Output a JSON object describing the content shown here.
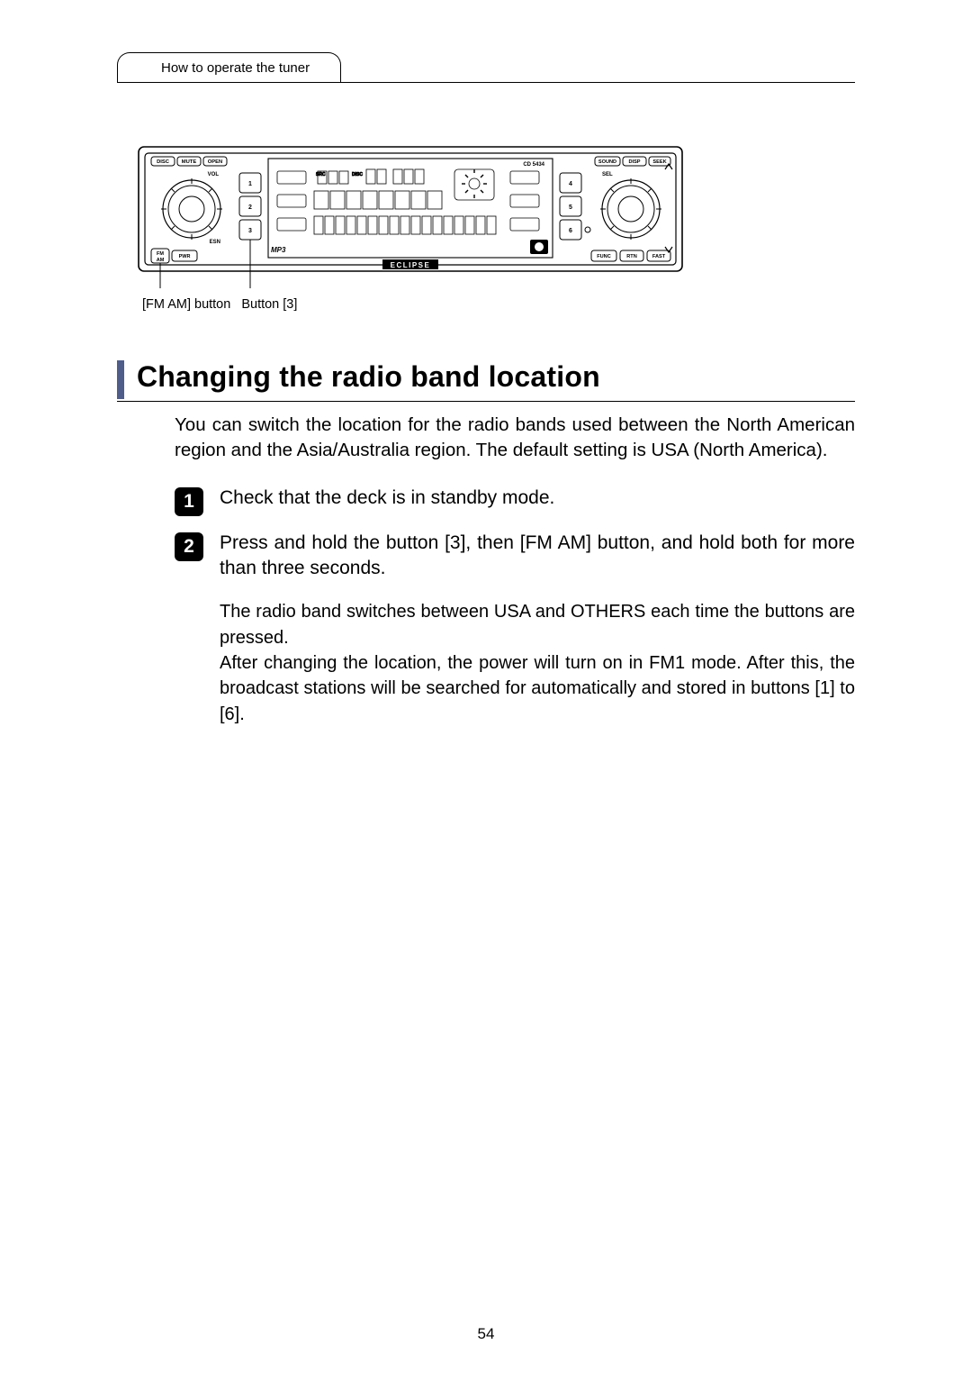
{
  "header": {
    "tab_label": "How to operate the tuner"
  },
  "figure": {
    "model": "CD 5434",
    "brand": "ECLIPSE",
    "left_btn_top_1": "DISC",
    "left_btn_top_2": "MUTE",
    "left_btn_top_3": "OPEN",
    "left_vol": "VOL",
    "left_esn": "ESN",
    "left_fmam": "FM\nAM",
    "left_pwr": "PWR",
    "left_mp3": "MP3",
    "preset_1": "1",
    "preset_2": "2",
    "preset_3": "3",
    "preset_4": "4",
    "preset_5": "5",
    "preset_6": "6",
    "right_btn_top_1": "SOUND",
    "right_btn_top_2": "DISP",
    "right_btn_top_3": "SEEK",
    "right_sel": "SEL",
    "right_func": "FUNC",
    "right_rtn": "RTN",
    "right_fast": "FAST",
    "lcd_src": "SRC",
    "lcd_disc": "DISC",
    "label_fmam": "[FM AM] button",
    "label_btn3": "Button [3]"
  },
  "heading": "Changing the radio band location",
  "intro": "You can switch the location for the radio bands used between the North American region and the Asia/Australia region. The default setting is USA (North America).",
  "steps": [
    {
      "num": "1",
      "title": "Check that the deck is in standby mode."
    },
    {
      "num": "2",
      "title": "Press and hold the button [3], then [FM AM] button, and hold both for more than three seconds.",
      "sub": "The radio band switches between USA and OTHERS each time the buttons are pressed.\nAfter changing the location, the power will turn on in FM1 mode. After this, the broadcast stations will be searched for automatically and stored in buttons [1] to [6]."
    }
  ],
  "page_number": "54"
}
